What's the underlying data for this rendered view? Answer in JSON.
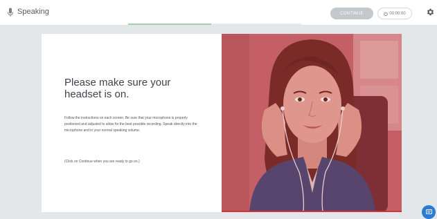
{
  "header": {
    "section_title": "Speaking",
    "continue_label": "CONTINUE",
    "timer_value": "00:00:00",
    "progress_fraction": 0.48
  },
  "icons": {
    "microphone": "microphone-icon",
    "timer": "stopwatch-icon",
    "settings": "gear-icon",
    "chat": "chat-icon"
  },
  "content": {
    "headline": "Please make sure your headset is on.",
    "instructions": "Follow the instructions on each screen. Be sure that your microphone is properly positioned and adjusted to allow for the best possible recording. Speak directly into the microphone and in your normal speaking volume.",
    "continue_note": "(Click on Continue when you are ready to go on.)"
  },
  "colors": {
    "accent_green": "#9fd3a6",
    "photo_tint": "#c0666b",
    "photo_line": "#d2303a",
    "chat_blue": "#2b7bd6",
    "button_disabled": "#c3c8cd"
  }
}
